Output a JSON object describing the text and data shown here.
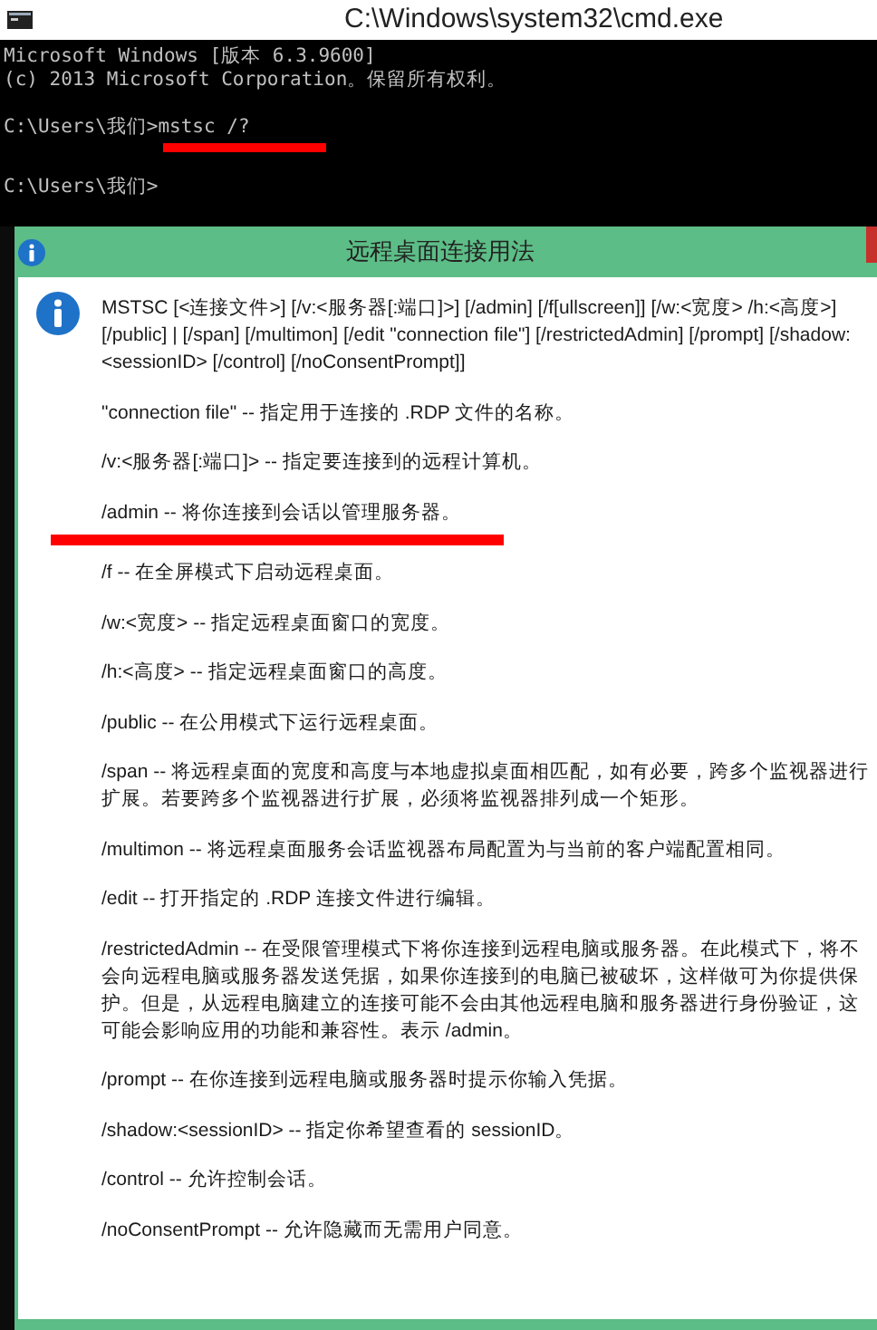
{
  "window": {
    "title": "C:\\Windows\\system32\\cmd.exe"
  },
  "console": {
    "blocks": [
      {
        "lines": [
          {
            "text": "Microsoft Windows [版本 6.3.9600]",
            "underlined": false
          },
          {
            "text": "(c) 2013 Microsoft Corporation。保留所有权利。",
            "underlined": false
          }
        ]
      },
      {
        "lines": [
          {
            "text": "C:\\Users\\我们>mstsc /?",
            "underlined": true
          }
        ]
      },
      {
        "lines": [
          {
            "text": "C:\\Users\\我们>",
            "underlined": false
          }
        ]
      }
    ]
  },
  "dialog": {
    "title": "远程桌面连接用法",
    "paragraphs": [
      {
        "text": "MSTSC [<连接文件>] [/v:<服务器[:端口]>] [/admin] [/f[ullscreen]] [/w:<宽度> /h:<高度>] [/public] | [/span] [/multimon] [/edit \"connection file\"] [/restrictedAdmin] [/prompt] [/shadow:<sessionID> [/control] [/noConsentPrompt]]",
        "underlined": false
      },
      {
        "text": "\"connection file\" -- 指定用于连接的 .RDP 文件的名称。",
        "underlined": false
      },
      {
        "text": "/v:<服务器[:端口]> -- 指定要连接到的远程计算机。",
        "underlined": false
      },
      {
        "text": "/admin -- 将你连接到会话以管理服务器。",
        "underlined": true
      },
      {
        "text": "/f -- 在全屏模式下启动远程桌面。",
        "underlined": false
      },
      {
        "text": "/w:<宽度> -- 指定远程桌面窗口的宽度。",
        "underlined": false
      },
      {
        "text": "/h:<高度> -- 指定远程桌面窗口的高度。",
        "underlined": false
      },
      {
        "text": "/public -- 在公用模式下运行远程桌面。",
        "underlined": false
      },
      {
        "text": "/span -- 将远程桌面的宽度和高度与本地虚拟桌面相匹配，如有必要，跨多个监视器进行扩展。若要跨多个监视器进行扩展，必须将监视器排列成一个矩形。",
        "underlined": false
      },
      {
        "text": "/multimon -- 将远程桌面服务会话监视器布局配置为与当前的客户端配置相同。",
        "underlined": false
      },
      {
        "text": "/edit -- 打开指定的 .RDP 连接文件进行编辑。",
        "underlined": false
      },
      {
        "text": "/restrictedAdmin -- 在受限管理模式下将你连接到远程电脑或服务器。在此模式下，将不会向远程电脑或服务器发送凭据，如果你连接到的电脑已被破坏，这样做可为你提供保护。但是，从远程电脑建立的连接可能不会由其他远程电脑和服务器进行身份验证，这可能会影响应用的功能和兼容性。表示 /admin。",
        "underlined": false
      },
      {
        "text": "/prompt -- 在你连接到远程电脑或服务器时提示你输入凭据。",
        "underlined": false
      },
      {
        "text": "/shadow:<sessionID> -- 指定你希望查看的 sessionID。",
        "underlined": false
      },
      {
        "text": "/control -- 允许控制会话。",
        "underlined": false
      },
      {
        "text": "/noConsentPrompt -- 允许隐藏而无需用户同意。",
        "underlined": false
      }
    ]
  }
}
